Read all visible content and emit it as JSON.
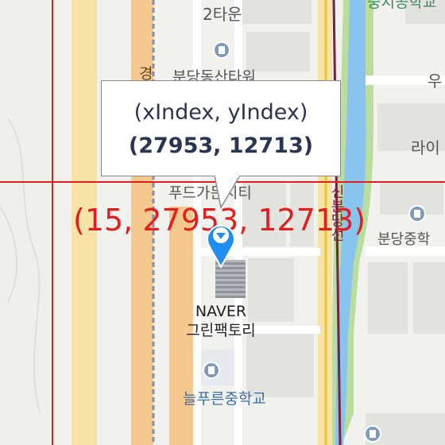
{
  "map": {
    "colors": {
      "background": "#f1f1ee",
      "block": "#e2e2de",
      "road_main": "#f5c98d",
      "road_alt": "#f7e3a6",
      "river": "#89c4ef",
      "green": "#b8dd9e",
      "grid_line": "#e02020",
      "rail": "#7a2040"
    },
    "places": {
      "town_2": "2타운",
      "bundang_building": "분당동산타워",
      "road_label_partial": "경",
      "foods_city": "푸드가든시티",
      "line_name": "신분당선",
      "bundang_mid": "분당중학",
      "lai_partial": "라이",
      "u_partial": "우",
      "top_right_partial": "중지공학교",
      "neulpureun": "늘푸른중학교"
    },
    "marker": {
      "title": "NAVER",
      "subtitle": "그린팩토리",
      "icon": "location-pin-icon"
    },
    "callout": {
      "line1": "(xIndex, yIndex)",
      "line2": "(27953, 12713)"
    },
    "grid_label": "(15, 27953, 12713)"
  }
}
